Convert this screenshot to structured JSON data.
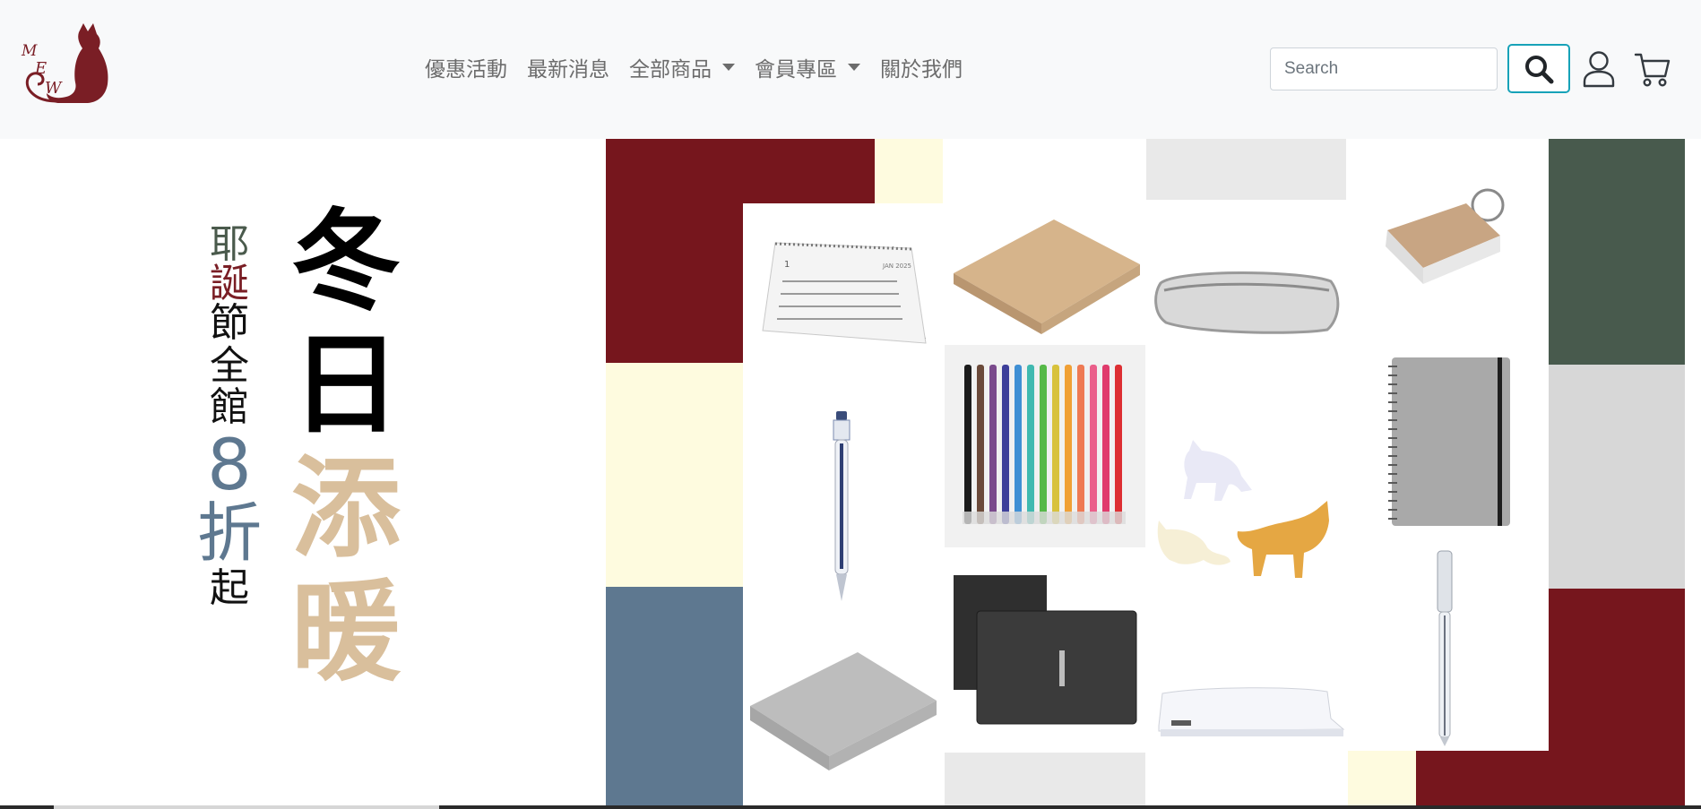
{
  "header": {
    "brand_logo": "cat-logo (MEW)",
    "nav_items": [
      {
        "label": "優惠活動",
        "dropdown": false
      },
      {
        "label": "最新消息",
        "dropdown": false
      },
      {
        "label": "全部商品",
        "dropdown": true
      },
      {
        "label": "會員專區",
        "dropdown": true
      },
      {
        "label": "關於我們",
        "dropdown": false
      }
    ],
    "search": {
      "placeholder": "Search",
      "value": ""
    },
    "search_button_icon": "search-icon",
    "user_icon": "user-icon",
    "cart_icon": "cart-icon"
  },
  "banner": {
    "tagline_chars": [
      {
        "char": "耶",
        "color": "#4a5a4c"
      },
      {
        "char": "誕",
        "color": "#7a1e25"
      },
      {
        "char": "節",
        "color": "#111111"
      },
      {
        "char": "全",
        "color": "#111111"
      },
      {
        "char": "館",
        "color": "#111111"
      },
      {
        "char": "8",
        "color": "#5e7890"
      },
      {
        "char": "折",
        "color": "#5e7890"
      },
      {
        "char": "起",
        "color": "#111111"
      }
    ],
    "headline_chars": [
      {
        "char": "冬",
        "color": "#000000"
      },
      {
        "char": "日",
        "color": "#000000"
      },
      {
        "char": "添",
        "color": "#d9bf9c"
      },
      {
        "char": "暖",
        "color": "#d9bf9c"
      }
    ],
    "products": [
      "desk-calendar",
      "kraft-memo-pad",
      "mesh-pencil-case",
      "ring-word-cards",
      "gel-pen",
      "color-pen-set",
      "cat-sticky-notes",
      "spiral-notebook",
      "gray-memo-block",
      "black-file-folders",
      "white-stapler",
      "clear-pen"
    ],
    "colors": {
      "burgundy": "#76161d",
      "cream": "#fefbdf",
      "slate": "#5e7890",
      "light_gray": "#e9e9e9",
      "dark_green": "#485a4d",
      "silver": "#d7d7d7"
    }
  }
}
